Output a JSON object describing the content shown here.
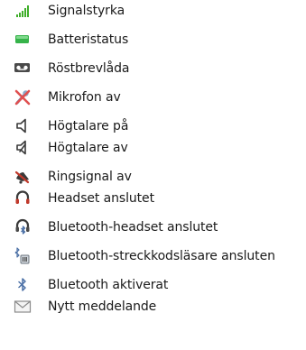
{
  "legend": {
    "items": [
      {
        "icon": "signal-strength-icon",
        "label": "Signalstyrka"
      },
      {
        "icon": "battery-status-icon",
        "label": "Batteristatus"
      },
      {
        "icon": "voicemail-icon",
        "label": "Röstbrevlåda"
      },
      {
        "icon": "microphone-off-icon",
        "label": "Mikrofon av"
      },
      {
        "icon": "speaker-on-icon",
        "label": "Högtalare på"
      },
      {
        "icon": "speaker-off-icon",
        "label": "Högtalare av"
      },
      {
        "icon": "ringer-off-icon",
        "label": "Ringsignal av"
      },
      {
        "icon": "headset-icon",
        "label": "Headset anslutet"
      },
      {
        "icon": "bluetooth-headset-icon",
        "label": "Bluetooth-headset anslutet"
      },
      {
        "icon": "bluetooth-barcode-scanner-icon",
        "label": "Bluetooth-streckkodsläsare ansluten"
      },
      {
        "icon": "bluetooth-icon",
        "label": "Bluetooth aktiverat"
      },
      {
        "icon": "envelope-icon",
        "label": "Nytt meddelande"
      }
    ]
  },
  "colors": {
    "signal": "#3fae2a",
    "battery": "#36b34a",
    "icon_dark": "#4a4a4a",
    "mic_red": "#e05050",
    "headset_red": "#c0392b",
    "bluetooth_blue": "#4a6fa5",
    "envelope_gray": "#8a8a8a"
  }
}
